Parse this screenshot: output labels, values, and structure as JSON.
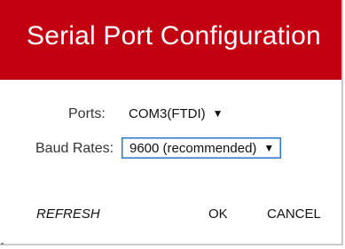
{
  "dialog": {
    "title": "Serial Port Configuration",
    "accent_color": "#c30012"
  },
  "form": {
    "ports": {
      "label": "Ports:",
      "value": "COM3(FTDI)"
    },
    "baud_rates": {
      "label": "Baud Rates:",
      "value": "9600 (recommended)"
    }
  },
  "actions": {
    "refresh_label": "REFRESH",
    "ok_label": "OK",
    "cancel_label": "CANCEL"
  }
}
